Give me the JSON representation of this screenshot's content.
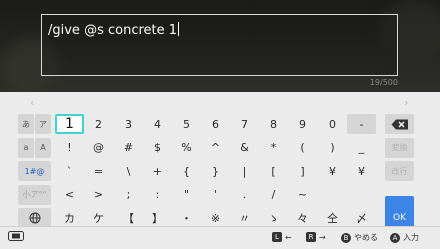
{
  "input": {
    "value": "/give @s concrete 1",
    "counter": "19/500"
  },
  "nav": {
    "left_arrow": "‹",
    "right_arrow": "›"
  },
  "keyboard": {
    "side": [
      "あ",
      "ア",
      "a",
      "A",
      "1#@",
      "小ア°°"
    ],
    "row1": [
      "1",
      "2",
      "3",
      "4",
      "5",
      "6",
      "7",
      "8",
      "9",
      "0",
      "-"
    ],
    "row2": [
      "!",
      "@",
      "#",
      "$",
      "%",
      "^",
      "&",
      "*",
      "(",
      ")",
      "_"
    ],
    "row3": [
      "`",
      "=",
      "\\",
      "+",
      "{",
      "}",
      "|",
      "[",
      "]",
      "¥"
    ],
    "row4": [
      "<",
      ">",
      ";",
      ":",
      "\"",
      "'",
      ".",
      "/",
      "~"
    ],
    "row5": [
      "カ",
      "ケ",
      "【",
      "】",
      "・",
      "※",
      "〃",
      "ゝ",
      "々",
      "仝",
      "〆"
    ],
    "convert_label": "変換",
    "newline_label": "改行",
    "ok_label": "OK",
    "backspace_label": "⌫"
  },
  "bottom": {
    "l_label": "L",
    "l_action": "←",
    "r_label": "R",
    "r_action": "→",
    "b_label": "B",
    "b_action": "やめる",
    "a_label": "A",
    "a_action": "入力"
  },
  "colors": {
    "accent": "#3c84e6",
    "selection": "#3fd1d4"
  }
}
